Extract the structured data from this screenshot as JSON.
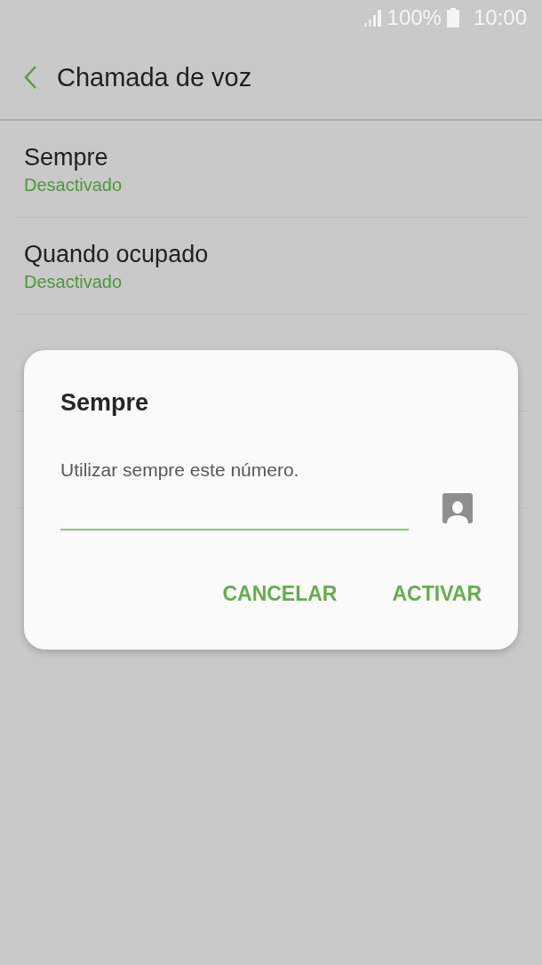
{
  "status_bar": {
    "battery": "100%",
    "time": "10:00"
  },
  "header": {
    "title": "Chamada de voz"
  },
  "options": [
    {
      "title": "Sempre",
      "status": "Desactivado"
    },
    {
      "title": "Quando ocupado",
      "status": "Desactivado"
    }
  ],
  "dialog": {
    "title": "Sempre",
    "message": "Utilizar sempre este número.",
    "buttons": [
      "CANCELAR",
      "ACTIVAR"
    ]
  }
}
